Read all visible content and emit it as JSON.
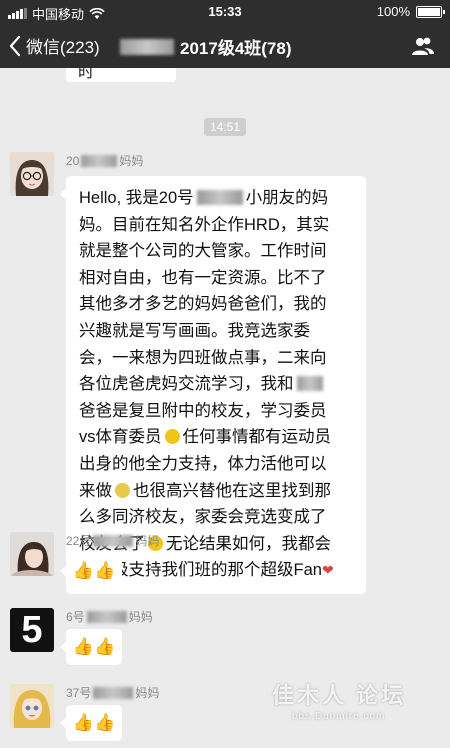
{
  "status_bar": {
    "carrier": "中国移动",
    "time": "15:33",
    "battery": "100%",
    "battery_level": 1.0
  },
  "nav": {
    "back_label": "微信(223)",
    "title": "2017级4班(78)"
  },
  "chat": {
    "previous_message_tail": "时",
    "timestamp": "14:51",
    "main_message": {
      "sender_prefix": "20",
      "sender_suffix": "妈妈",
      "lines": [
        [
          "Hello, 我是20号",
          "小朋友的妈"
        ],
        [
          "妈。目前在知名外企作HRD，其实"
        ],
        [
          "就是整个公司的大管家。工作时间"
        ],
        [
          "相对自由，也有一定资源。比不了"
        ],
        [
          "其他多才多艺的妈妈爸爸们，我的"
        ],
        [
          "兴趣就是写写画画。我竞选家委"
        ],
        [
          "会，一来想为四班做点事，二来向"
        ],
        [
          "各位虎爸虎妈交流学习，我和"
        ],
        [
          "爸爸是复旦附中的校友，学习委员"
        ],
        [
          "vs体育委员",
          "任何事情都有运动员"
        ],
        [
          "出身的他全力支持，体力活他可以"
        ],
        [
          "来做",
          "也很高兴替他在这里找到那"
        ],
        [
          "么多同济校友，家委会竞选变成了"
        ],
        [
          "校友会了",
          "无论结果如何，我都会"
        ],
        [
          "是积极支持我们班的那个超级Fan"
        ]
      ]
    },
    "replies": [
      {
        "sender_prefix": "22号",
        "sender_suffix": "妈妈",
        "content": "👍👍"
      },
      {
        "sender_prefix": "6号",
        "sender_suffix": "妈妈",
        "content": "👍👍",
        "avatar_text": "5"
      },
      {
        "sender_prefix": "37号",
        "sender_suffix": "妈妈",
        "content": "👍👍"
      }
    ]
  },
  "watermark": {
    "line1": "佳木人 论坛",
    "line2": "bbs.Dunmire.com"
  }
}
